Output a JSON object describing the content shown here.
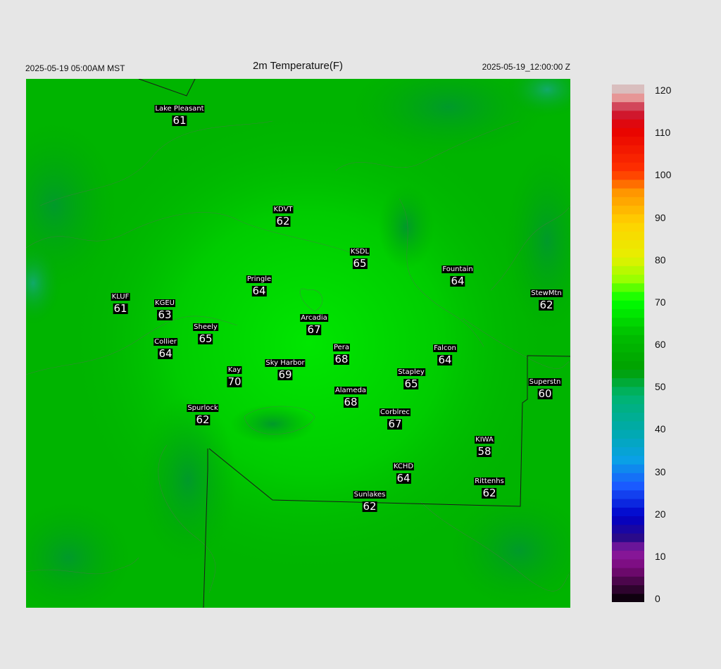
{
  "header": {
    "title": "2m Temperature(F)",
    "valid_local": "2025-05-19 05:00AM MST",
    "valid_utc": "2025-05-19_12:00:00 Z"
  },
  "stations": [
    {
      "name": "Lake Pleasant",
      "value": "61"
    },
    {
      "name": "KDVT",
      "value": "62"
    },
    {
      "name": "KSDL",
      "value": "65"
    },
    {
      "name": "Fountain",
      "value": "64"
    },
    {
      "name": "Pringle",
      "value": "64"
    },
    {
      "name": "KLUF",
      "value": "61"
    },
    {
      "name": "KGEU",
      "value": "63"
    },
    {
      "name": "StewMtn",
      "value": "62"
    },
    {
      "name": "Arcadia",
      "value": "67"
    },
    {
      "name": "Sheely",
      "value": "65"
    },
    {
      "name": "Collier",
      "value": "64"
    },
    {
      "name": "Pera",
      "value": "68"
    },
    {
      "name": "Falcon",
      "value": "64"
    },
    {
      "name": "Sky Harbor",
      "value": "69"
    },
    {
      "name": "Kay",
      "value": "70"
    },
    {
      "name": "Stapley",
      "value": "65"
    },
    {
      "name": "Superstn",
      "value": "60"
    },
    {
      "name": "Alameda",
      "value": "68"
    },
    {
      "name": "Spurlock",
      "value": "62"
    },
    {
      "name": "Corblrec",
      "value": "67"
    },
    {
      "name": "KIWA",
      "value": "58"
    },
    {
      "name": "KCHD",
      "value": "64"
    },
    {
      "name": "Rittenhs",
      "value": "62"
    },
    {
      "name": "Sunlakes",
      "value": "62"
    }
  ],
  "colorbar": {
    "ticks": [
      "120",
      "110",
      "100",
      "90",
      "80",
      "70",
      "60",
      "50",
      "40",
      "30",
      "20",
      "10",
      "0"
    ],
    "stops": [
      {
        "value": 0,
        "color": "#000000"
      },
      {
        "value": 8,
        "color": "#7a0a7a"
      },
      {
        "value": 12,
        "color": "#8a1aa0"
      },
      {
        "value": 15,
        "color": "#2a0a8a"
      },
      {
        "value": 20,
        "color": "#0000c8"
      },
      {
        "value": 27,
        "color": "#1a5aff"
      },
      {
        "value": 33,
        "color": "#0aa0e6"
      },
      {
        "value": 40,
        "color": "#00aaaa"
      },
      {
        "value": 48,
        "color": "#00b46e"
      },
      {
        "value": 54,
        "color": "#00a000"
      },
      {
        "value": 62,
        "color": "#00be00"
      },
      {
        "value": 70,
        "color": "#00ff00"
      },
      {
        "value": 75,
        "color": "#9aff00"
      },
      {
        "value": 80,
        "color": "#e6f000"
      },
      {
        "value": 88,
        "color": "#ffd200"
      },
      {
        "value": 95,
        "color": "#ff9600"
      },
      {
        "value": 100,
        "color": "#ff3200"
      },
      {
        "value": 110,
        "color": "#e60000"
      },
      {
        "value": 114,
        "color": "#c81e3c"
      },
      {
        "value": 117,
        "color": "#e69696"
      },
      {
        "value": 120,
        "color": "#d2d2d2"
      }
    ]
  },
  "colors": {
    "background": "#e6e6e6",
    "field_base": "#00b800",
    "field_warm": "#00e000",
    "label_bg": "#000000",
    "label_fg": "#ffffff"
  }
}
